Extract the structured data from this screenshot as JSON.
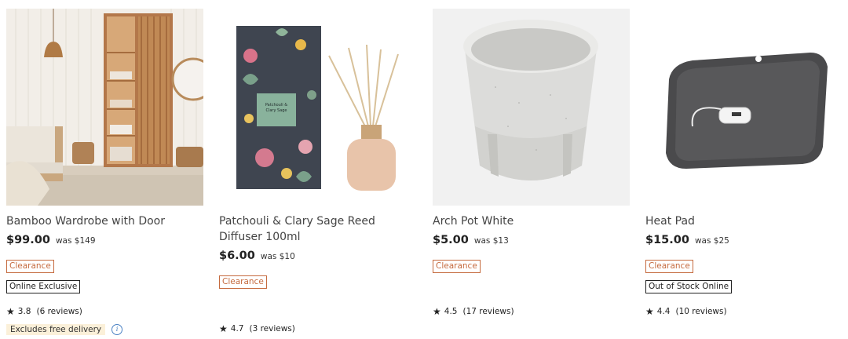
{
  "products": [
    {
      "title": "Bamboo Wardrobe with Door",
      "price": "$99.00",
      "was": "was $149",
      "tags": [
        "Clearance",
        "Online Exclusive"
      ],
      "rating": "3.8",
      "reviews": "(6 reviews)",
      "delivery": "Excludes free delivery",
      "image_icon": "bamboo-wardrobe-image"
    },
    {
      "title": "Patchouli & Clary Sage Reed Diffuser 100ml",
      "price": "$6.00",
      "was": "was $10",
      "tags": [
        "Clearance"
      ],
      "rating": "4.7",
      "reviews": "(3 reviews)",
      "box_label": "Patchouli & Clary Sage",
      "image_icon": "reed-diffuser-image"
    },
    {
      "title": "Arch Pot White",
      "price": "$5.00",
      "was": "was $13",
      "tags": [
        "Clearance"
      ],
      "rating": "4.5",
      "reviews": "(17 reviews)",
      "image_icon": "arch-pot-image"
    },
    {
      "title": "Heat Pad",
      "price": "$15.00",
      "was": "was $25",
      "tags": [
        "Clearance",
        "Out of Stock Online"
      ],
      "rating": "4.4",
      "reviews": "(10 reviews)",
      "image_icon": "heat-pad-image"
    }
  ],
  "colors": {
    "clearance": "#c56a3e",
    "delivery_bg": "#fbf0d9",
    "info": "#4b82c4"
  }
}
